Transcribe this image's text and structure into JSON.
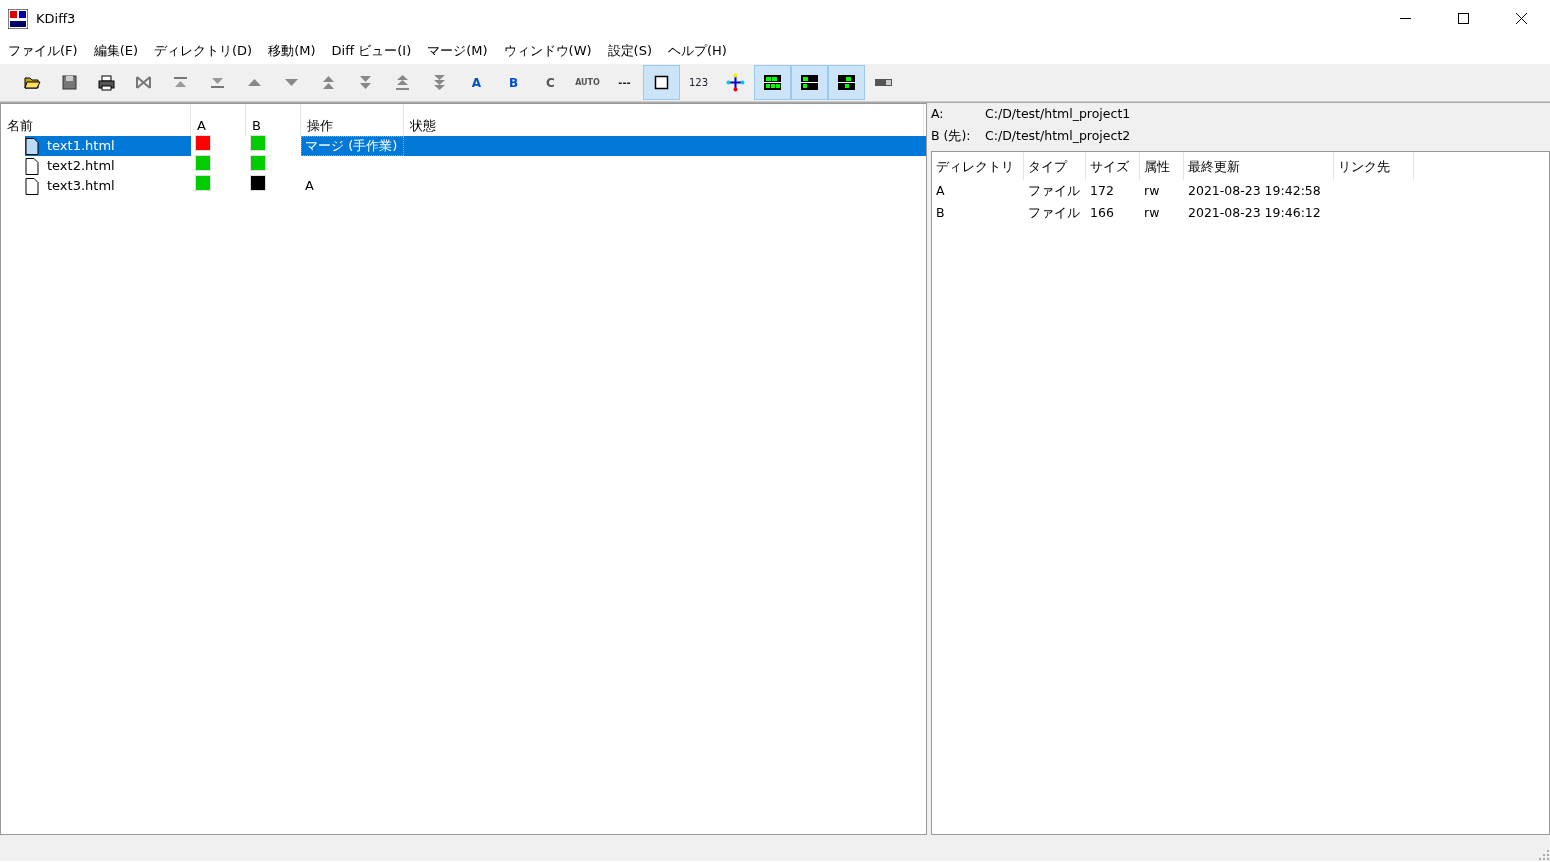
{
  "window": {
    "title": "KDiff3"
  },
  "menu": [
    "ファイル(F)",
    "編集(E)",
    "ディレクトリ(D)",
    "移動(M)",
    "Diff ビュー(I)",
    "マージ(M)",
    "ウィンドウ(W)",
    "設定(S)",
    "ヘルプ(H)"
  ],
  "toolbar": [
    {
      "kind": "open",
      "selected": false
    },
    {
      "kind": "save",
      "selected": false
    },
    {
      "kind": "print",
      "selected": false
    },
    {
      "kind": "bowtie",
      "selected": false
    },
    {
      "kind": "top",
      "selected": false
    },
    {
      "kind": "bottom",
      "selected": false
    },
    {
      "kind": "up",
      "selected": false
    },
    {
      "kind": "down",
      "selected": false
    },
    {
      "kind": "up2",
      "selected": false
    },
    {
      "kind": "down2",
      "selected": false
    },
    {
      "kind": "up3",
      "selected": false
    },
    {
      "kind": "down3",
      "selected": false
    },
    {
      "kind": "letter",
      "label": "A",
      "selected": false
    },
    {
      "kind": "letter",
      "label": "B",
      "selected": false
    },
    {
      "kind": "letter",
      "label": "C",
      "selected": false
    },
    {
      "kind": "auto",
      "label": "AUTO",
      "selected": false
    },
    {
      "kind": "text",
      "label": "---",
      "selected": false
    },
    {
      "kind": "square",
      "selected": true
    },
    {
      "kind": "text",
      "label": "123",
      "selected": false
    },
    {
      "kind": "arrows",
      "selected": false
    },
    {
      "kind": "grid1",
      "selected": true
    },
    {
      "kind": "grid2",
      "selected": true
    },
    {
      "kind": "grid3",
      "selected": true
    },
    {
      "kind": "toggle",
      "selected": false
    }
  ],
  "file_list": {
    "columns": [
      "名前",
      "A",
      "B",
      "操作",
      "状態"
    ],
    "rows": [
      {
        "name": "text1.html",
        "a": {
          "color": "#ff0000"
        },
        "b": {
          "color": "#00cc00"
        },
        "operation": "マージ (手作業)",
        "selected": true
      },
      {
        "name": "text2.html",
        "a": {
          "color": "#00cc00"
        },
        "b": {
          "color": "#00cc00"
        },
        "operation": "",
        "selected": false
      },
      {
        "name": "text3.html",
        "a": {
          "color": "#00cc00"
        },
        "b": {
          "color": "#000000"
        },
        "operation": "A",
        "selected": false
      }
    ]
  },
  "info": {
    "paths": [
      {
        "label": "A:",
        "path": "C:/D/test/html_project1"
      },
      {
        "label": "B (先):",
        "path": "C:/D/test/html_project2"
      }
    ],
    "columns": [
      "ディレクトリ",
      "タイプ",
      "サイズ",
      "属性",
      "最終更新",
      "リンク先"
    ],
    "rows": [
      [
        "A",
        "ファイル",
        "172",
        "rw",
        "2021-08-23 19:42:58"
      ],
      [
        "B",
        "ファイル",
        "166",
        "rw",
        "2021-08-23 19:46:12"
      ]
    ]
  }
}
